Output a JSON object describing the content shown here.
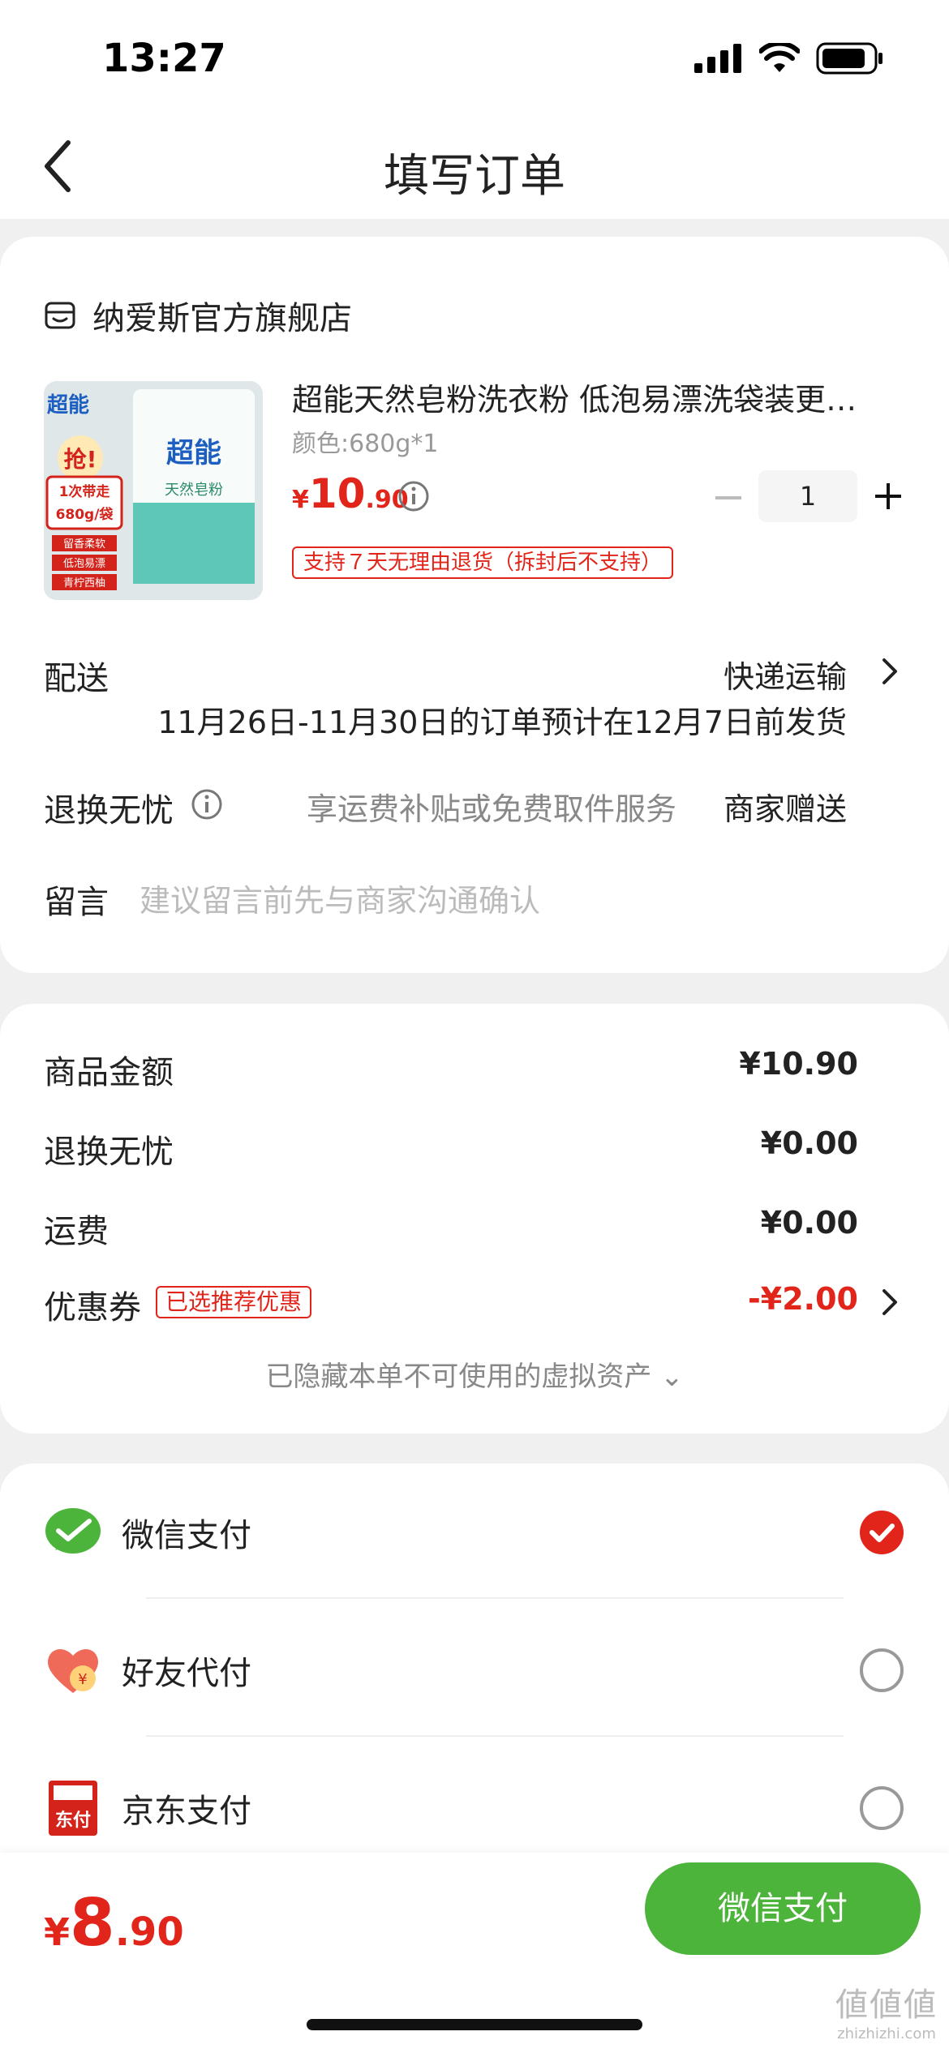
{
  "status_bar": {
    "time": "13:27"
  },
  "nav": {
    "title": "填写订单"
  },
  "store": {
    "name": "纳爱斯官方旗舰店"
  },
  "product": {
    "title": "超能天然皂粉洗衣粉 低泡易漂洗袋装更…",
    "spec": "颜色:680g*1",
    "price_symbol": "¥",
    "price_int": "10",
    "price_dec": ".90",
    "quantity": "1",
    "return_tag": "支持７天无理由退货（拆封后不支持）",
    "image_texts": {
      "brand": "超能",
      "badge": "抢!",
      "offer_1": "1次带走",
      "offer_2": "680g/袋",
      "tag_1": "留香柔软",
      "tag_2": "低泡易漂",
      "tag_3": "青柠西柚",
      "pack_name": "天然皂粉"
    }
  },
  "delivery": {
    "label": "配送",
    "value": "快递运输",
    "note": "11月26日-11月30日的订单预计在12月7日前发货"
  },
  "worry_free": {
    "label": "退换无忧",
    "desc": "享运费补贴或免费取件服务",
    "value": "商家赠送"
  },
  "message": {
    "label": "留言",
    "placeholder": "建议留言前先与商家沟通确认"
  },
  "amounts": {
    "goods_label": "商品金额",
    "goods_value": "¥10.90",
    "worry_label": "退换无忧",
    "worry_value": "¥0.00",
    "shipping_label": "运费",
    "shipping_value": "¥0.00",
    "coupon_label": "优惠券",
    "coupon_badge": "已选推荐优惠",
    "coupon_value": "-¥2.00",
    "hidden_assets": "已隐藏本单不可使用的虚拟资产 ⌄"
  },
  "payment": {
    "methods": [
      {
        "label": "微信支付",
        "selected": true
      },
      {
        "label": "好友代付",
        "selected": false
      },
      {
        "label": "京东支付",
        "selected": false
      }
    ],
    "friend_icon_text": "¥",
    "jd_icon_text": "东付"
  },
  "footer": {
    "total_symbol": "¥",
    "total_int": "8",
    "total_dec": ".90",
    "pay_button": "微信支付"
  },
  "watermark": {
    "logo": "値値値",
    "url": "zhizhizhi.com"
  },
  "colors": {
    "accent_red": "#e1251b",
    "wechat_green": "#4cb43a"
  }
}
